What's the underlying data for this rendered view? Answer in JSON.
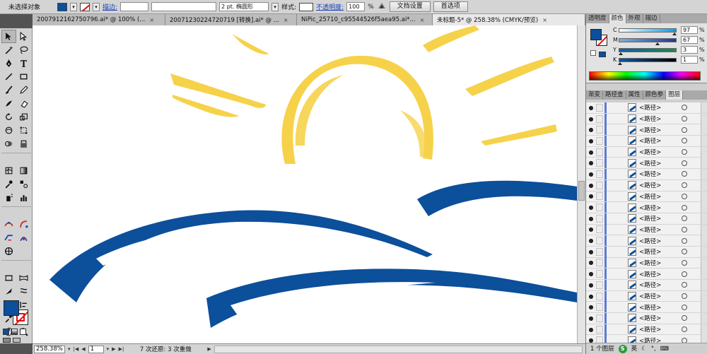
{
  "control_bar": {
    "selection_label": "未选择对象",
    "stroke_label": "描边:",
    "brush_label": "2 pt. 椭圆形",
    "style_label": "样式:",
    "opacity_label": "不透明度:",
    "opacity_value": "100",
    "opacity_unit": "%",
    "doc_setup_button": "文档设置",
    "preferences_button": "首选项",
    "dropdown_glyph": "▾"
  },
  "tabs": [
    {
      "label": "2007912162750796.ai* @ 100% (..."
    },
    {
      "label": "20071230224720719 [转换].ai* @ ..."
    },
    {
      "label": "NiPic_25710_c95544526f5aea95.ai*..."
    },
    {
      "label": "未标题-5* @ 258.38% (CMYK/预览)"
    }
  ],
  "status_bar": {
    "zoom": "258.38%",
    "page": "1",
    "history": "7 次还原: 3 次重做",
    "nav_first": "|◀",
    "nav_prev": "◀",
    "nav_next": "▶",
    "nav_last": "▶|",
    "dropdown": "▾",
    "play": "▶"
  },
  "color_panel": {
    "tabs": [
      {
        "label": "透明度"
      },
      {
        "label": "颜色"
      },
      {
        "label": "外观"
      },
      {
        "label": "描边"
      }
    ],
    "channels": [
      {
        "label": "C",
        "value": "97",
        "unit": "%",
        "level": 0.97,
        "gradient": "linear-gradient(90deg,#fff,#00a0e6)"
      },
      {
        "label": "M",
        "value": "67",
        "unit": "%",
        "level": 0.67,
        "gradient": "linear-gradient(90deg,#7fb0d8,#22349a)"
      },
      {
        "label": "Y",
        "value": "3",
        "unit": "%",
        "level": 0.03,
        "gradient": "linear-gradient(90deg,#0e5fa8,#1f8a4a)"
      },
      {
        "label": "K",
        "value": "1",
        "unit": "%",
        "level": 0.01,
        "gradient": "linear-gradient(90deg,#0c58a0,#000)"
      }
    ]
  },
  "layers_panel": {
    "tabs": [
      {
        "label": "渐变"
      },
      {
        "label": "路径查"
      },
      {
        "label": "属性"
      },
      {
        "label": "颜色参"
      },
      {
        "label": "图层"
      }
    ],
    "rows": [
      {
        "name": "<路径>"
      },
      {
        "name": "<路径>"
      },
      {
        "name": "<路径>"
      },
      {
        "name": "<路径>"
      },
      {
        "name": "<路径>"
      },
      {
        "name": "<路径>"
      },
      {
        "name": "<路径>"
      },
      {
        "name": "<路径>"
      },
      {
        "name": "<路径>"
      },
      {
        "name": "<路径>"
      },
      {
        "name": "<路径>"
      },
      {
        "name": "<路径>"
      },
      {
        "name": "<路径>"
      },
      {
        "name": "<路径>"
      },
      {
        "name": "<路径>"
      },
      {
        "name": "<路径>"
      },
      {
        "name": "<路径>"
      },
      {
        "name": "<路径>"
      },
      {
        "name": "<路径>"
      },
      {
        "name": "<路径>"
      },
      {
        "name": "<路径>"
      },
      {
        "name": "<路径>"
      }
    ],
    "footer": "1 个图层",
    "ime_lang": "英",
    "ime_s": "S"
  },
  "colors": {
    "fill": "#0c4f9b",
    "sun": "#f6d24a",
    "wave": "#0c4f9b"
  }
}
